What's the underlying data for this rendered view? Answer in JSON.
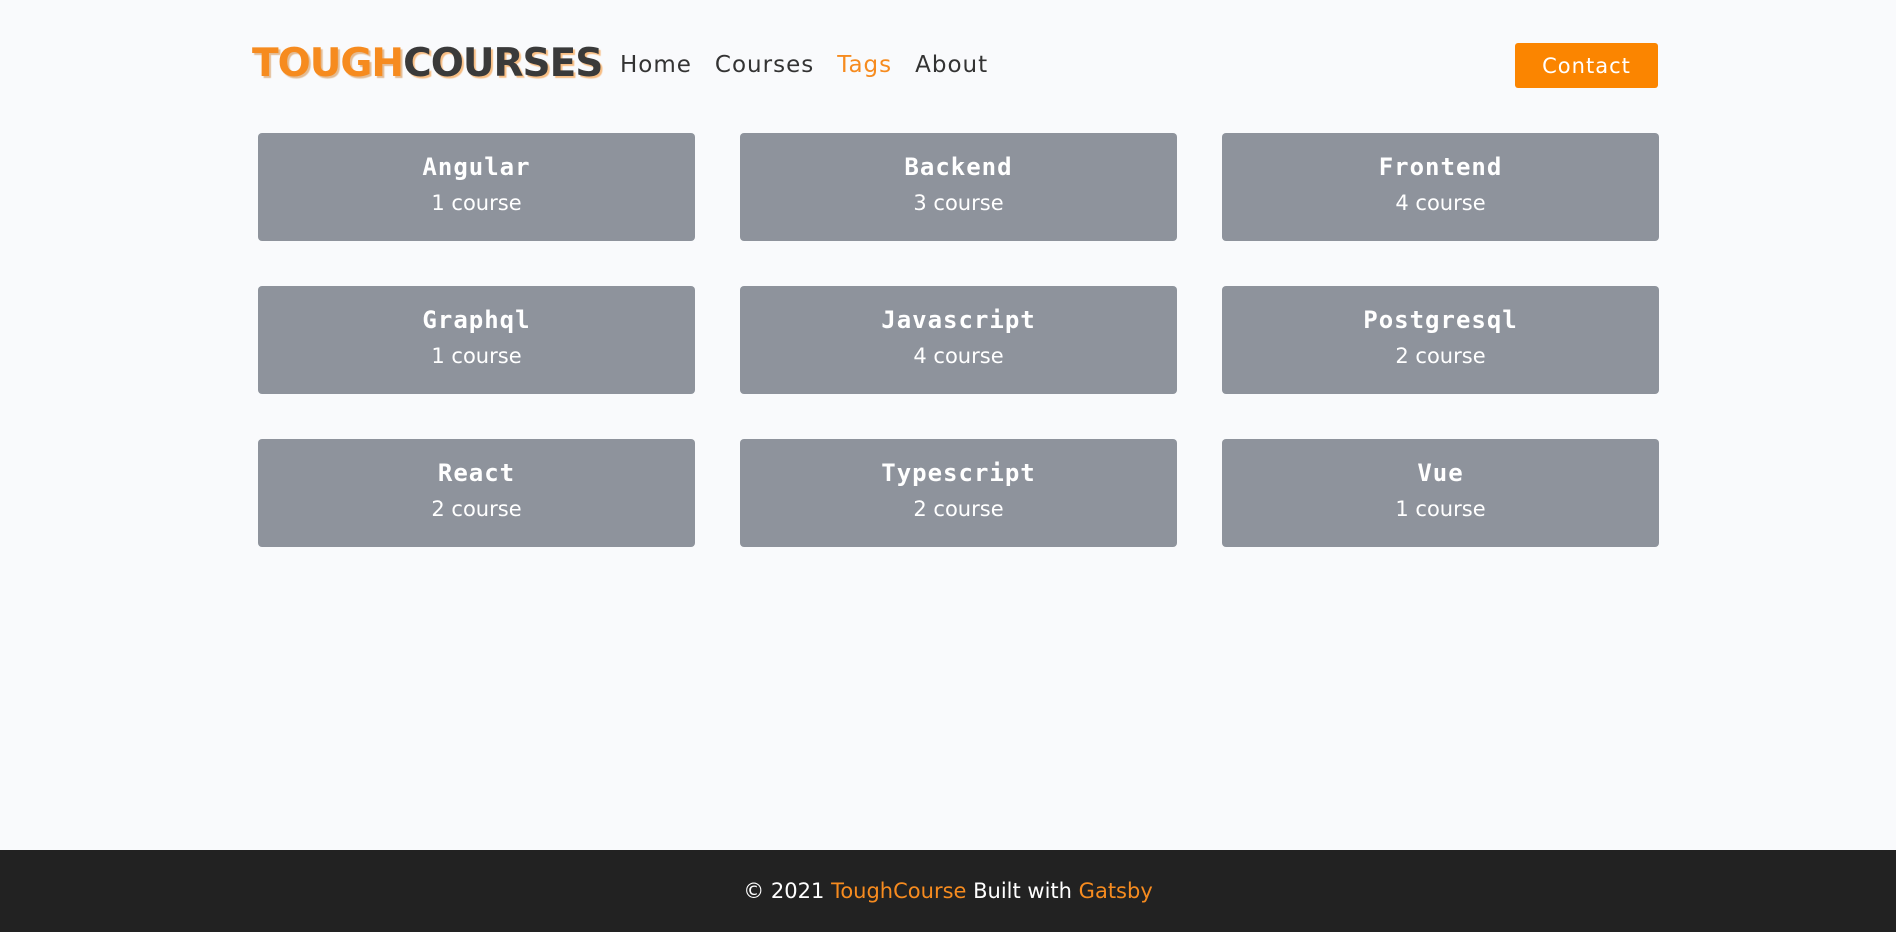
{
  "header": {
    "logo_part1": "TOUGH",
    "logo_part2": "COURSES",
    "nav": [
      "Home",
      "Courses",
      "Tags",
      "About"
    ],
    "active_nav": "Tags",
    "contact_label": "Contact"
  },
  "tags": [
    {
      "name": "Angular",
      "count": "1 course"
    },
    {
      "name": "Backend",
      "count": "3 course"
    },
    {
      "name": "Frontend",
      "count": "4 course"
    },
    {
      "name": "Graphql",
      "count": "1 course"
    },
    {
      "name": "Javascript",
      "count": "4 course"
    },
    {
      "name": "Postgresql",
      "count": "2 course"
    },
    {
      "name": "React",
      "count": "2 course"
    },
    {
      "name": "Typescript",
      "count": "2 course"
    },
    {
      "name": "Vue",
      "count": "1 course"
    }
  ],
  "footer": {
    "copyright": "© 2021",
    "brand": "ToughCourse",
    "built_with": "Built with",
    "framework": "Gatsby"
  },
  "colors": {
    "accent": "#f68b1f",
    "button": "#fb8500",
    "card": "#8e939c",
    "footer_bg": "#222222",
    "page_bg": "#f9fafc"
  }
}
